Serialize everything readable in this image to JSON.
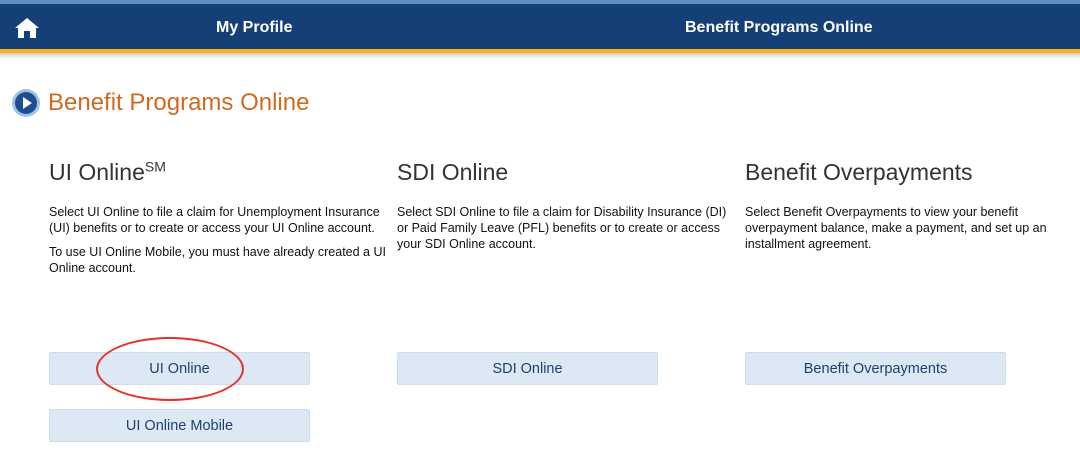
{
  "nav": {
    "home_icon": "home-icon",
    "my_profile": "My Profile",
    "benefit_programs_online": "Benefit Programs Online"
  },
  "page": {
    "title": "Benefit Programs Online",
    "title_icon": "play-circle-icon"
  },
  "sections": [
    {
      "title": "UI Online",
      "title_sup": "SM",
      "paragraphs": [
        "Select UI Online to file a claim for Unemployment Insurance (UI) benefits or to create or access your UI Online account.",
        "To use UI Online Mobile, you must have already created a UI Online account."
      ],
      "buttons": [
        "UI Online",
        "UI Online Mobile"
      ]
    },
    {
      "title": "SDI Online",
      "paragraphs": [
        "Select SDI Online to file a claim for Disability Insurance (DI) or Paid Family Leave (PFL) benefits or to create or access your SDI Online account."
      ],
      "buttons": [
        "SDI Online"
      ]
    },
    {
      "title": "Benefit Overpayments",
      "paragraphs": [
        "Select Benefit Overpayments to view your benefit overpayment balance, make a payment, and set up an installment agreement."
      ],
      "buttons": [
        "Benefit Overpayments"
      ]
    }
  ],
  "colors": {
    "navbar": "#143f77",
    "accent_gold": "#f4b41a",
    "title_orange": "#d2691e",
    "button_bg": "#dce9f5",
    "annotation_red": "#e6302a"
  }
}
